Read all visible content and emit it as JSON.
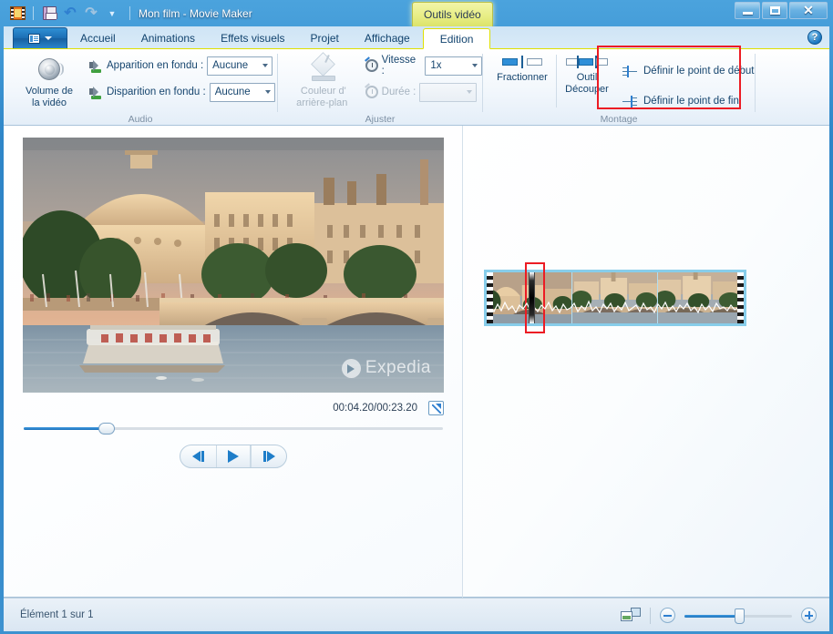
{
  "window": {
    "title": "Mon film - Movie Maker",
    "app_icon": "film-strip-icon",
    "quick_access": [
      {
        "name": "save-icon",
        "label": "Enregistrer"
      },
      {
        "name": "undo-icon",
        "label": "Annuler"
      },
      {
        "name": "redo-icon",
        "label": "Rétablir"
      },
      {
        "name": "customize-qat-icon",
        "label": "Personnaliser"
      }
    ],
    "controls": {
      "minimize": "Réduire",
      "maximize": "Agrandir",
      "close": "Fermer",
      "close_glyph": "✕"
    },
    "contextual_tab_group": "Outils vidéo"
  },
  "ribbon": {
    "file_menu": "Fichier",
    "help": "?",
    "tabs": [
      {
        "label": "Accueil",
        "selected": false
      },
      {
        "label": "Animations",
        "selected": false
      },
      {
        "label": "Effets visuels",
        "selected": false
      },
      {
        "label": "Projet",
        "selected": false
      },
      {
        "label": "Affichage",
        "selected": false
      },
      {
        "label": "Edition",
        "selected": true
      }
    ],
    "groups": {
      "audio": {
        "label": "Audio",
        "volume_button": "Volume de\nla vidéo",
        "volume_button_line1": "Volume de",
        "volume_button_line2": "la vidéo",
        "fade_in_label": "Apparition en fondu :",
        "fade_in_value": "Aucune",
        "fade_out_label": "Disparition en fondu :",
        "fade_out_value": "Aucune"
      },
      "adjust": {
        "label": "Ajuster",
        "background_color_line1": "Couleur d'",
        "background_color_line2": "arrière-plan",
        "speed_label": "Vitesse :",
        "speed_value": "1x",
        "duration_label": "Durée :",
        "duration_value": ""
      },
      "editing": {
        "label": "Montage",
        "split_button": "Fractionner",
        "trim_tool_line1": "Outil",
        "trim_tool_line2": "Découper",
        "set_start_point": "Définir le point de début",
        "set_end_point": "Définir le point de fin"
      }
    }
  },
  "preview": {
    "timecode": "00:04.20/00:23.20",
    "current_time": "00:04.20",
    "total_time": "00:23.20",
    "fullscreen_label": "Plein écran",
    "watermark": "Expedia",
    "seek_percent": 19,
    "transport": {
      "previous_frame": "Image précédente",
      "play": "Lecture",
      "next_frame": "Image suivante"
    }
  },
  "storyboard": {
    "clip_selected": true,
    "frame_count": 3,
    "playhead_percent": 16
  },
  "statusbar": {
    "item_status": "Élément 1 sur 1",
    "view_toggle_label": "Miniatures du storyboard",
    "zoom_out_label": "Zoom arrière",
    "zoom_in_label": "Zoom avant",
    "zoom_percent": 50
  },
  "colors": {
    "accent_blue": "#2f7fd0",
    "contextual_yellow": "#e8ee86",
    "annotation_red": "#ec1c24",
    "clip_selection": "#87cdea"
  }
}
